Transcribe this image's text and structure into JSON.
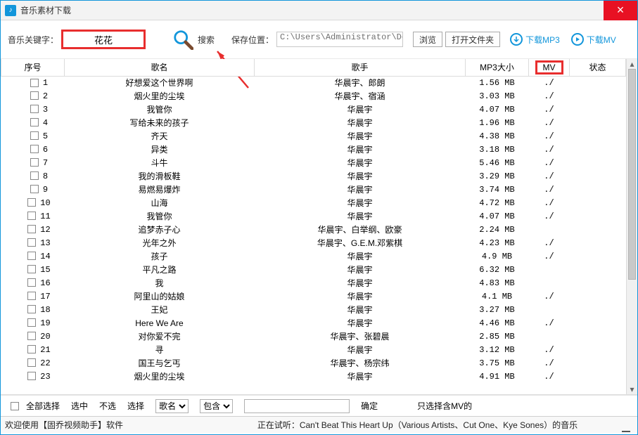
{
  "window": {
    "title": "音乐素材下载"
  },
  "toolbar": {
    "keyword_label": "音乐关键字：",
    "keyword_value": "花花",
    "search_btn": "搜索",
    "save_label": "保存位置：",
    "save_path": "C:\\Users\\Administrator\\Deskto",
    "browse_btn": "浏览",
    "open_folder_btn": "打开文件夹",
    "download_mp3": "下载MP3",
    "download_mv": "下载MV"
  },
  "headers": {
    "index": "序号",
    "name": "歌名",
    "singer": "歌手",
    "size": "MP3大小",
    "mv": "MV",
    "state": "状态"
  },
  "rows": [
    {
      "i": "1",
      "name": "好想爱这个世界啊",
      "singer": "华晨宇、郎朗",
      "size": "1.56 MB",
      "mv": "./"
    },
    {
      "i": "2",
      "name": "烟火里的尘埃",
      "singer": "华晨宇、宿涵",
      "size": "3.03 MB",
      "mv": "./"
    },
    {
      "i": "3",
      "name": "我管你",
      "singer": "华晨宇",
      "size": "4.07 MB",
      "mv": "./"
    },
    {
      "i": "4",
      "name": "写给未来的孩子",
      "singer": "华晨宇",
      "size": "1.96 MB",
      "mv": "./"
    },
    {
      "i": "5",
      "name": "齐天",
      "singer": "华晨宇",
      "size": "4.38 MB",
      "mv": "./"
    },
    {
      "i": "6",
      "name": "异类",
      "singer": "华晨宇",
      "size": "3.18 MB",
      "mv": "./"
    },
    {
      "i": "7",
      "name": "斗牛",
      "singer": "华晨宇",
      "size": "5.46 MB",
      "mv": "./"
    },
    {
      "i": "8",
      "name": "我的滑板鞋",
      "singer": "华晨宇",
      "size": "3.29 MB",
      "mv": "./"
    },
    {
      "i": "9",
      "name": "易燃易爆炸",
      "singer": "华晨宇",
      "size": "3.74 MB",
      "mv": "./"
    },
    {
      "i": "10",
      "name": "山海",
      "singer": "华晨宇",
      "size": "4.72 MB",
      "mv": "./"
    },
    {
      "i": "11",
      "name": "我管你",
      "singer": "华晨宇",
      "size": "4.07 MB",
      "mv": "./"
    },
    {
      "i": "12",
      "name": "追梦赤子心",
      "singer": "华晨宇、白举纲、欧豪",
      "size": "2.24 MB",
      "mv": ""
    },
    {
      "i": "13",
      "name": "光年之外",
      "singer": "华晨宇、G.E.M.邓紫棋",
      "size": "4.23 MB",
      "mv": "./"
    },
    {
      "i": "14",
      "name": "孩子",
      "singer": "华晨宇",
      "size": "4.9 MB",
      "mv": "./"
    },
    {
      "i": "15",
      "name": "平凡之路",
      "singer": "华晨宇",
      "size": "6.32 MB",
      "mv": ""
    },
    {
      "i": "16",
      "name": "我",
      "singer": "华晨宇",
      "size": "4.83 MB",
      "mv": ""
    },
    {
      "i": "17",
      "name": "阿里山的姑娘",
      "singer": "华晨宇",
      "size": "4.1 MB",
      "mv": "./"
    },
    {
      "i": "18",
      "name": "王妃",
      "singer": "华晨宇",
      "size": "3.27 MB",
      "mv": ""
    },
    {
      "i": "19",
      "name": "Here We Are",
      "singer": "华晨宇",
      "size": "4.46 MB",
      "mv": "./"
    },
    {
      "i": "20",
      "name": "对你爱不完",
      "singer": "华晨宇、张碧晨",
      "size": "2.85 MB",
      "mv": ""
    },
    {
      "i": "21",
      "name": "寻",
      "singer": "华晨宇",
      "size": "3.12 MB",
      "mv": "./"
    },
    {
      "i": "22",
      "name": "国王与乞丐",
      "singer": "华晨宇、杨宗纬",
      "size": "3.75 MB",
      "mv": "./"
    },
    {
      "i": "23",
      "name": "烟火里的尘埃",
      "singer": "华晨宇",
      "size": "4.91 MB",
      "mv": "./"
    }
  ],
  "filter": {
    "select_all": "全部选择",
    "inverse": "选中",
    "none": "不选",
    "select_label": "选择",
    "field_selected": "歌名",
    "op_selected": "包含",
    "confirm": "确定",
    "only_mv": "只选择含MV的"
  },
  "statusbar": {
    "welcome": "欢迎使用【固乔视频助手】软件",
    "now_playing": "正在试听：Can't Beat This Heart Up（Various Artists、Cut One、Kye Sones）的音乐"
  }
}
